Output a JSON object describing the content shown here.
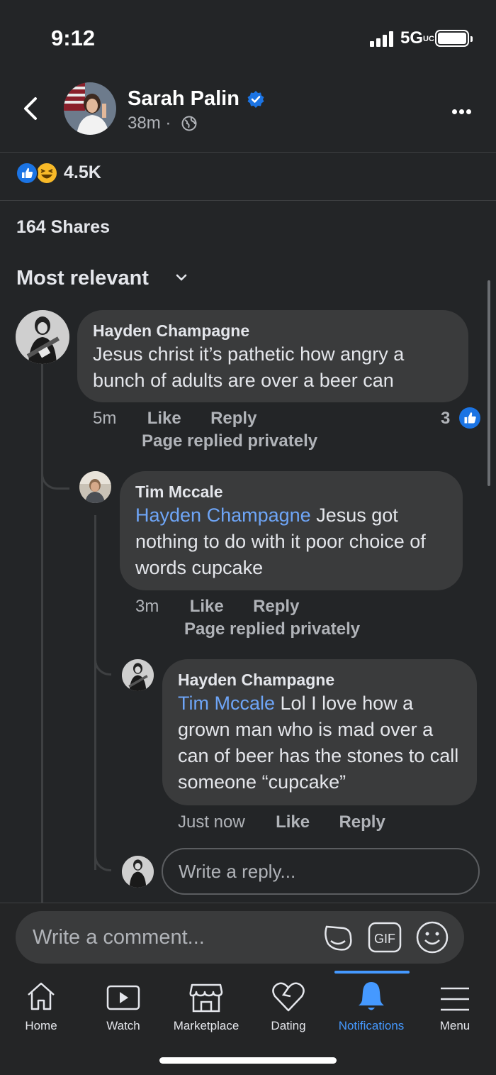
{
  "status_bar": {
    "time": "9:12",
    "network": "5G",
    "network_suffix": "UC"
  },
  "post_header": {
    "name": "Sarah Palin",
    "time": "38m ·"
  },
  "reactions": {
    "count": "4.5K"
  },
  "shares": "164 Shares",
  "sort": {
    "label": "Most relevant"
  },
  "comments": [
    {
      "author": "Hayden Champagne",
      "text": "Jesus christ it’s pathetic how angry a bunch of adults are over a beer can",
      "time": "5m",
      "like": "Like",
      "reply": "Reply",
      "page_reply": "Page replied privately",
      "like_count": "3"
    },
    {
      "author": "Tim Mccale",
      "mention": "Hayden Champagne",
      "text": "Jesus got nothing to do with it poor choice of words cupcake",
      "time": "3m",
      "like": "Like",
      "reply": "Reply",
      "page_reply": "Page replied privately"
    },
    {
      "author": "Hayden Champagne",
      "mention": "Tim Mccale",
      "text": "Lol I love how a grown man who is mad over a can of beer has the stones to call someone “cupcake”",
      "time": "Just now",
      "like": "Like",
      "reply": "Reply"
    }
  ],
  "reply_input": {
    "placeholder": "Write a reply..."
  },
  "comment_input": {
    "placeholder": "Write a comment..."
  },
  "tab_bar": {
    "tabs": [
      {
        "label": "Home",
        "icon": "home-icon"
      },
      {
        "label": "Watch",
        "icon": "watch-icon"
      },
      {
        "label": "Marketplace",
        "icon": "marketplace-icon"
      },
      {
        "label": "Dating",
        "icon": "dating-icon"
      },
      {
        "label": "Notifications",
        "icon": "bell-icon",
        "active": true
      },
      {
        "label": "Menu",
        "icon": "menu-icon"
      }
    ]
  },
  "colors": {
    "background": "#232527",
    "bubble": "#3a3b3c",
    "accent": "#4599ff",
    "mention": "#6ea5f7",
    "like_blue": "#1b74e4"
  }
}
